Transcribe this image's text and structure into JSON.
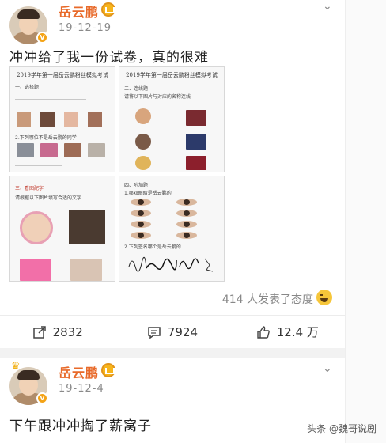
{
  "post1": {
    "author": "岳云鹏",
    "date": "19-12-19",
    "text": "冲冲给了我一份试卷，真的很难",
    "images": [
      {
        "title": "2019学年第一届岳云鹏粉丝模拟考试",
        "section": "一、选择题",
        "question": "2.下列哪位不是岳云鹏的同学"
      },
      {
        "title": "2019学年第一届岳云鹏粉丝模拟考试",
        "section": "二、连线题",
        "question": "请将以下图片与对应的名称连线"
      },
      {
        "title": "",
        "section": "三、看图配字",
        "question": "请根据以下图片填写合适的文字"
      },
      {
        "title": "",
        "section": "四、附加题",
        "question": "1.哪双眼睛是岳云鹏的",
        "question2": "2.下列签名哪个是岳云鹏的"
      }
    ],
    "reactions": "414 人发表了态度",
    "actions": {
      "share": "2832",
      "comment": "7924",
      "like": "12.4 万"
    }
  },
  "post2": {
    "author": "岳云鹏",
    "date": "19-12-4",
    "text": "下午跟冲冲掏了薪窝子"
  },
  "watermark": "头条 @魏哥说剧",
  "colors": {
    "name": "#e86a2a",
    "badge": "#f7b51c",
    "divider": "#f2f2f2"
  }
}
